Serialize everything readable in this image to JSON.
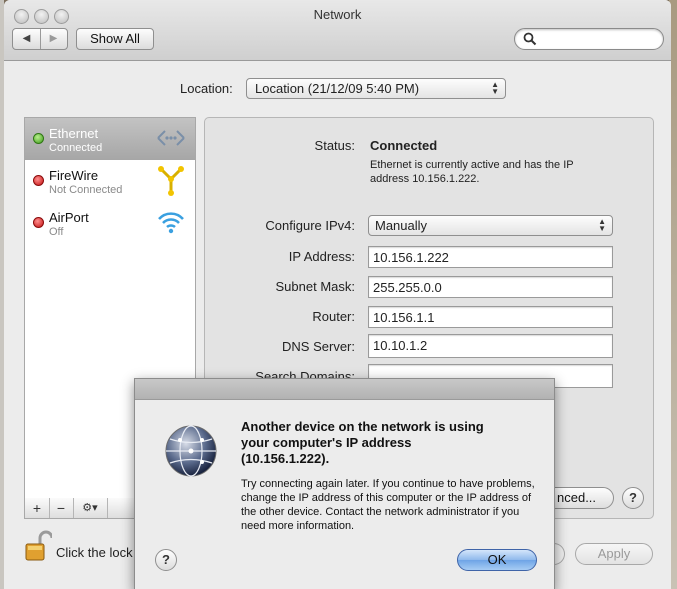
{
  "window": {
    "title": "Network"
  },
  "toolbar": {
    "show_all_label": "Show All",
    "search_placeholder": ""
  },
  "location": {
    "label": "Location:",
    "value": "Location (21/12/09 5:40 PM)"
  },
  "services": [
    {
      "name": "Ethernet",
      "status": "Connected",
      "status_color": "#3f9a1c",
      "icon": "ethernet-icon"
    },
    {
      "name": "FireWire",
      "status": "Not Connected",
      "status_color": "#c41010",
      "icon": "firewire-icon"
    },
    {
      "name": "AirPort",
      "status": "Off",
      "status_color": "#c41010",
      "icon": "airport-icon"
    }
  ],
  "list_toolbar": {
    "add": "+",
    "remove": "−",
    "action": "⚙▾"
  },
  "details": {
    "status_label": "Status:",
    "status_value": "Connected",
    "status_desc_line1": "Ethernet is currently active and has the IP",
    "status_desc_line2": "address 10.156.1.222.",
    "configure_label": "Configure IPv4:",
    "configure_value": "Manually",
    "ip_label": "IP Address:",
    "ip_value": "10.156.1.222",
    "subnet_label": "Subnet Mask:",
    "subnet_value": "255.255.0.0",
    "router_label": "Router:",
    "router_value": "10.156.1.1",
    "dns_label": "DNS Server:",
    "dns_value": "10.10.1.2",
    "search_domains_label": "Search Domains:",
    "search_domains_value": "",
    "advanced_label": "nced...",
    "help": "?"
  },
  "footer": {
    "lock_text": "Click the lock",
    "apply_label": "Apply"
  },
  "dialog": {
    "title_line1": "Another device on the network is using",
    "title_line2": "your computer's IP address",
    "title_line3": "(10.156.1.222).",
    "body": "Try connecting again later. If you continue to have problems, change the IP address of this computer or the IP address of the other device. Contact the network administrator if you need more information.",
    "ok_label": "OK",
    "help": "?"
  },
  "colors": {
    "ok_button": "#6ea4e6",
    "selection": "#a6a6a6"
  }
}
